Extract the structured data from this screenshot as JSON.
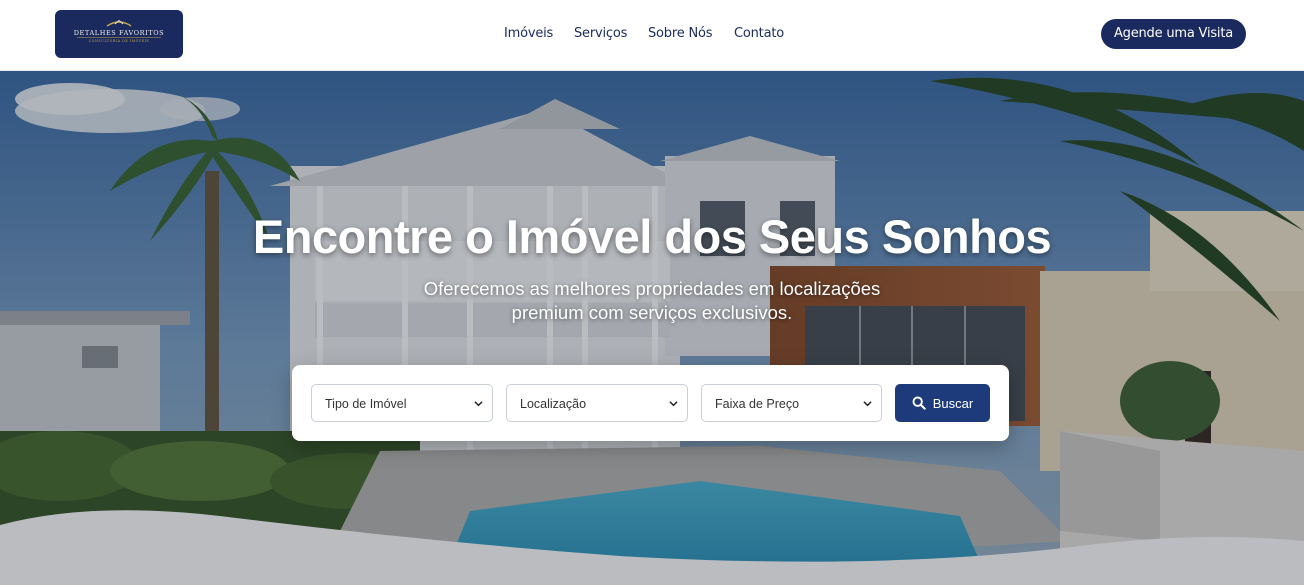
{
  "header": {
    "logo": {
      "name": "DETALHES FAVORITOS",
      "tagline": "CONSULTORIA DE IMÓVEIS"
    },
    "nav": {
      "items": [
        {
          "label": "Imóveis"
        },
        {
          "label": "Serviços"
        },
        {
          "label": "Sobre Nós"
        },
        {
          "label": "Contato"
        }
      ]
    },
    "cta_label": "Agende uma Visita"
  },
  "hero": {
    "title": "Encontre o Imóvel dos Seus Sonhos",
    "subtitle_line1": "Oferecemos as melhores propriedades em localizações",
    "subtitle_line2": "premium com serviços exclusivos."
  },
  "search": {
    "property_type": {
      "selected": "Tipo de Imóvel"
    },
    "location": {
      "selected": "Localização"
    },
    "price_range": {
      "selected": "Faixa de Preço"
    },
    "button_label": "Buscar",
    "button_icon": "search-icon"
  },
  "colors": {
    "brand_navy": "#1a2a5e",
    "button_blue": "#1d3a7a",
    "accent_gold": "#c9a84c"
  }
}
